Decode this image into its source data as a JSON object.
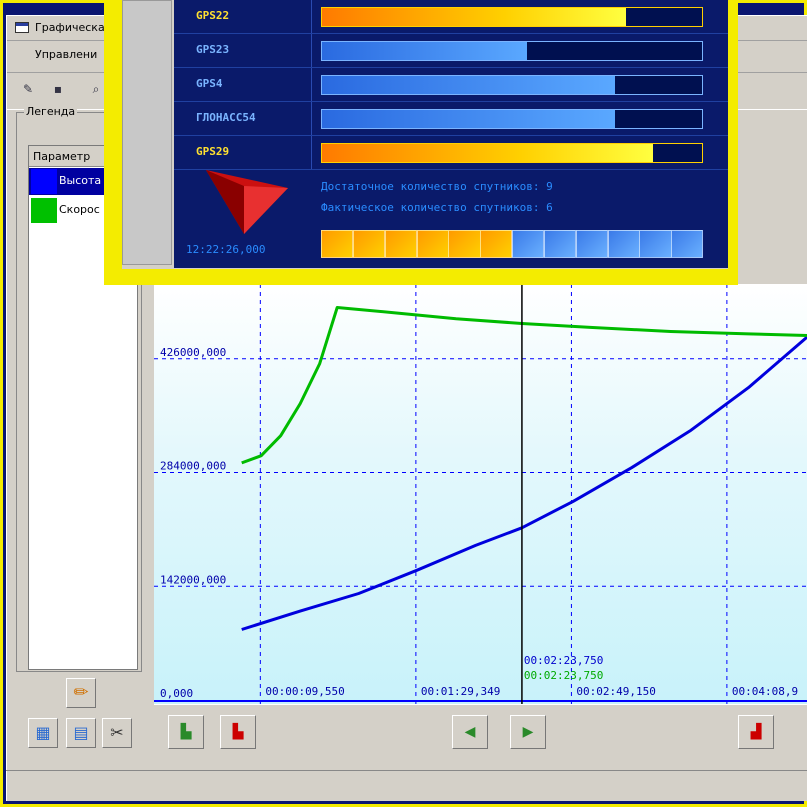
{
  "window": {
    "title": "Графическа",
    "menu": "Управлени"
  },
  "legend": {
    "group_label": "Легенда",
    "column_header": "Параметр",
    "items": [
      {
        "name": "Высота",
        "color": "#0000ff",
        "selected": true
      },
      {
        "name": "Скорос",
        "color": "#00c000",
        "selected": false
      }
    ]
  },
  "gps": {
    "satellites": [
      {
        "name": "GPS22",
        "level": 0.8,
        "style": "orange"
      },
      {
        "name": "GPS23",
        "level": 0.54,
        "style": "blue"
      },
      {
        "name": "GPS4",
        "level": 0.77,
        "style": "blue"
      },
      {
        "name": "ГЛОНАСС54",
        "level": 0.77,
        "style": "blue"
      },
      {
        "name": "GPS29",
        "level": 0.87,
        "style": "orange"
      }
    ],
    "sufficient_label": "Достаточное количество спутников: 9",
    "actual_label": "Фактическое количество спутников: 6",
    "time": "12:22:26,000",
    "segments_total": 12,
    "segments_filled": 6
  },
  "chart_data": {
    "type": "line",
    "y_ticks": [
      "0,000",
      "142000,000",
      "284000,000",
      "426000,000"
    ],
    "x_ticks": [
      "00:00:09,550",
      "00:01:29,349",
      "00:02:49,150",
      "00:04:08,9"
    ],
    "cursor_label_blue": "00:02:23,750",
    "cursor_label_green": "00:02:23,750",
    "cursor_seconds": 143.75,
    "x_range_seconds": [
      -45,
      290
    ],
    "y_range": [
      0,
      500000
    ],
    "grid": true,
    "series": [
      {
        "name": "Высота",
        "color": "#0000dd",
        "x": [
          0,
          30,
          60,
          90,
          120,
          143.75,
          170,
          200,
          230,
          260,
          290
        ],
        "y": [
          88000,
          111000,
          133000,
          162000,
          193000,
          215000,
          248000,
          290000,
          336000,
          390000,
          453000
        ]
      },
      {
        "name": "Скорос",
        "color": "#00bb00",
        "x": [
          0,
          10,
          20,
          30,
          40,
          49,
          80,
          110,
          143.75,
          180,
          220,
          260,
          290
        ],
        "y": [
          296000,
          305000,
          330000,
          370000,
          420000,
          490000,
          483000,
          476000,
          470000,
          465000,
          460000,
          457000,
          455000
        ]
      }
    ],
    "colors": {
      "grid": "#0000ff",
      "axis": "#0000ff",
      "cursor": "#000000",
      "tick_text": "#0000aa"
    }
  }
}
